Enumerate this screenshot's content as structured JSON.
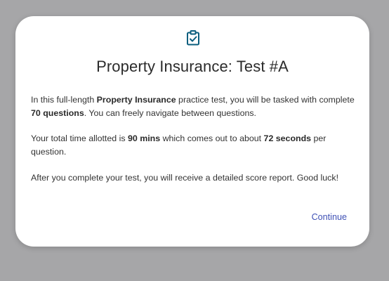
{
  "dialog": {
    "icon": "clipboard-check-icon",
    "title": "Property Insurance: Test #A",
    "paragraph1": {
      "t1": "In this full-length ",
      "b1": "Property Insurance",
      "t2": " practice test, you will be tasked with complete ",
      "b2": "70 questions",
      "t3": ". You can freely navigate between questions."
    },
    "paragraph2": {
      "t1": "Your total time allotted is ",
      "b1": "90 mins",
      "t2": " which comes out to about ",
      "b2": "72 seconds",
      "t3": " per question."
    },
    "paragraph3": "After you complete your test, you will receive a detailed score report. Good luck!",
    "continue_label": "Continue"
  },
  "colors": {
    "overlay": "#a6a6a8",
    "icon": "#0b5e7e",
    "link": "#3f51b5"
  }
}
